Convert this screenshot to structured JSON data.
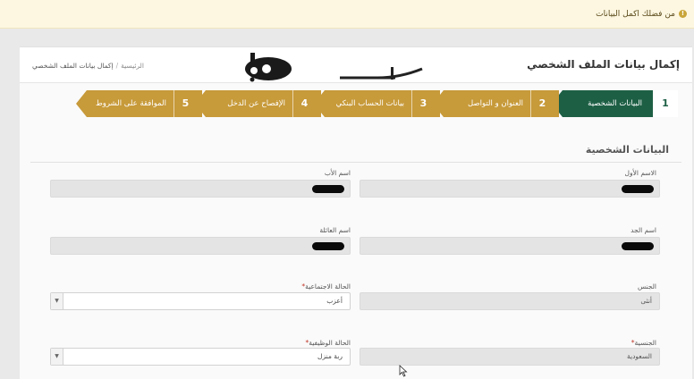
{
  "alert": {
    "text": "من فضلك اكمل البيانات",
    "icon": "warning-icon"
  },
  "header": {
    "title": "إكمال بيانات الملف الشخصي",
    "breadcrumb": {
      "home": "الرئيسية",
      "separator": "/",
      "current": "إكمال بيانات الملف الشخصي"
    }
  },
  "watermark": {
    "text": "ماهو!"
  },
  "steps": [
    {
      "num": "1",
      "label": "البيانات الشخصية",
      "active": true
    },
    {
      "num": "2",
      "label": "العنوان و التواصل",
      "active": false
    },
    {
      "num": "3",
      "label": "بيانات الحساب البنكي",
      "active": false
    },
    {
      "num": "4",
      "label": "الإفصاح عن الدخل",
      "active": false
    },
    {
      "num": "5",
      "label": "الموافقة على الشروط",
      "active": false
    }
  ],
  "section": {
    "title": "البيانات الشخصية"
  },
  "form": {
    "first_name": {
      "label": "الاسم الأول",
      "value": ""
    },
    "father_name": {
      "label": "اسم الأب",
      "value": ""
    },
    "grandfather_name": {
      "label": "اسم الجد",
      "value": ""
    },
    "family_name": {
      "label": "اسم العائلة",
      "value": ""
    },
    "gender": {
      "label": "الجنس",
      "value": "أنثى"
    },
    "marital_status": {
      "label": "الحالة الاجتماعية",
      "required": "*",
      "value": "أعزب"
    },
    "nationality": {
      "label": "الجنسية",
      "required": "*",
      "value": "السعودية"
    },
    "employment_status": {
      "label": "الحالة الوظيفية",
      "required": "*",
      "value": "ربة منزل"
    }
  },
  "colors": {
    "active_step": "#1d5f45",
    "inactive_step": "#c79a3a",
    "alert_bg": "#fdf7e1"
  }
}
